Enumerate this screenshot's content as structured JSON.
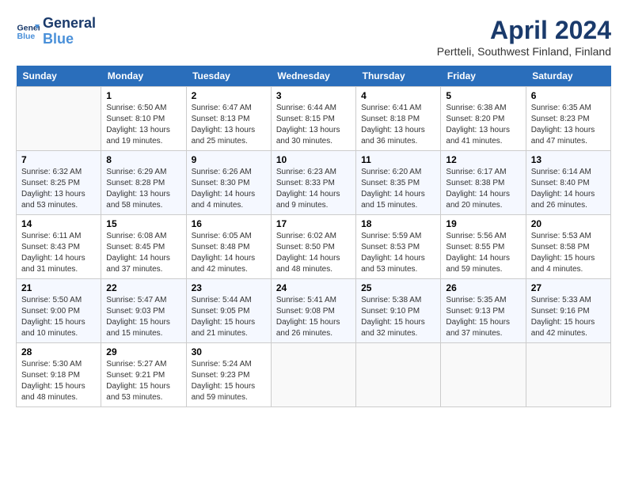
{
  "header": {
    "logo_line1": "General",
    "logo_line2": "Blue",
    "title": "April 2024",
    "subtitle": "Pertteli, Southwest Finland, Finland"
  },
  "days_of_week": [
    "Sunday",
    "Monday",
    "Tuesday",
    "Wednesday",
    "Thursday",
    "Friday",
    "Saturday"
  ],
  "weeks": [
    [
      {
        "day": "",
        "info": ""
      },
      {
        "day": "1",
        "info": "Sunrise: 6:50 AM\nSunset: 8:10 PM\nDaylight: 13 hours\nand 19 minutes."
      },
      {
        "day": "2",
        "info": "Sunrise: 6:47 AM\nSunset: 8:13 PM\nDaylight: 13 hours\nand 25 minutes."
      },
      {
        "day": "3",
        "info": "Sunrise: 6:44 AM\nSunset: 8:15 PM\nDaylight: 13 hours\nand 30 minutes."
      },
      {
        "day": "4",
        "info": "Sunrise: 6:41 AM\nSunset: 8:18 PM\nDaylight: 13 hours\nand 36 minutes."
      },
      {
        "day": "5",
        "info": "Sunrise: 6:38 AM\nSunset: 8:20 PM\nDaylight: 13 hours\nand 41 minutes."
      },
      {
        "day": "6",
        "info": "Sunrise: 6:35 AM\nSunset: 8:23 PM\nDaylight: 13 hours\nand 47 minutes."
      }
    ],
    [
      {
        "day": "7",
        "info": "Sunrise: 6:32 AM\nSunset: 8:25 PM\nDaylight: 13 hours\nand 53 minutes."
      },
      {
        "day": "8",
        "info": "Sunrise: 6:29 AM\nSunset: 8:28 PM\nDaylight: 13 hours\nand 58 minutes."
      },
      {
        "day": "9",
        "info": "Sunrise: 6:26 AM\nSunset: 8:30 PM\nDaylight: 14 hours\nand 4 minutes."
      },
      {
        "day": "10",
        "info": "Sunrise: 6:23 AM\nSunset: 8:33 PM\nDaylight: 14 hours\nand 9 minutes."
      },
      {
        "day": "11",
        "info": "Sunrise: 6:20 AM\nSunset: 8:35 PM\nDaylight: 14 hours\nand 15 minutes."
      },
      {
        "day": "12",
        "info": "Sunrise: 6:17 AM\nSunset: 8:38 PM\nDaylight: 14 hours\nand 20 minutes."
      },
      {
        "day": "13",
        "info": "Sunrise: 6:14 AM\nSunset: 8:40 PM\nDaylight: 14 hours\nand 26 minutes."
      }
    ],
    [
      {
        "day": "14",
        "info": "Sunrise: 6:11 AM\nSunset: 8:43 PM\nDaylight: 14 hours\nand 31 minutes."
      },
      {
        "day": "15",
        "info": "Sunrise: 6:08 AM\nSunset: 8:45 PM\nDaylight: 14 hours\nand 37 minutes."
      },
      {
        "day": "16",
        "info": "Sunrise: 6:05 AM\nSunset: 8:48 PM\nDaylight: 14 hours\nand 42 minutes."
      },
      {
        "day": "17",
        "info": "Sunrise: 6:02 AM\nSunset: 8:50 PM\nDaylight: 14 hours\nand 48 minutes."
      },
      {
        "day": "18",
        "info": "Sunrise: 5:59 AM\nSunset: 8:53 PM\nDaylight: 14 hours\nand 53 minutes."
      },
      {
        "day": "19",
        "info": "Sunrise: 5:56 AM\nSunset: 8:55 PM\nDaylight: 14 hours\nand 59 minutes."
      },
      {
        "day": "20",
        "info": "Sunrise: 5:53 AM\nSunset: 8:58 PM\nDaylight: 15 hours\nand 4 minutes."
      }
    ],
    [
      {
        "day": "21",
        "info": "Sunrise: 5:50 AM\nSunset: 9:00 PM\nDaylight: 15 hours\nand 10 minutes."
      },
      {
        "day": "22",
        "info": "Sunrise: 5:47 AM\nSunset: 9:03 PM\nDaylight: 15 hours\nand 15 minutes."
      },
      {
        "day": "23",
        "info": "Sunrise: 5:44 AM\nSunset: 9:05 PM\nDaylight: 15 hours\nand 21 minutes."
      },
      {
        "day": "24",
        "info": "Sunrise: 5:41 AM\nSunset: 9:08 PM\nDaylight: 15 hours\nand 26 minutes."
      },
      {
        "day": "25",
        "info": "Sunrise: 5:38 AM\nSunset: 9:10 PM\nDaylight: 15 hours\nand 32 minutes."
      },
      {
        "day": "26",
        "info": "Sunrise: 5:35 AM\nSunset: 9:13 PM\nDaylight: 15 hours\nand 37 minutes."
      },
      {
        "day": "27",
        "info": "Sunrise: 5:33 AM\nSunset: 9:16 PM\nDaylight: 15 hours\nand 42 minutes."
      }
    ],
    [
      {
        "day": "28",
        "info": "Sunrise: 5:30 AM\nSunset: 9:18 PM\nDaylight: 15 hours\nand 48 minutes."
      },
      {
        "day": "29",
        "info": "Sunrise: 5:27 AM\nSunset: 9:21 PM\nDaylight: 15 hours\nand 53 minutes."
      },
      {
        "day": "30",
        "info": "Sunrise: 5:24 AM\nSunset: 9:23 PM\nDaylight: 15 hours\nand 59 minutes."
      },
      {
        "day": "",
        "info": ""
      },
      {
        "day": "",
        "info": ""
      },
      {
        "day": "",
        "info": ""
      },
      {
        "day": "",
        "info": ""
      }
    ]
  ]
}
